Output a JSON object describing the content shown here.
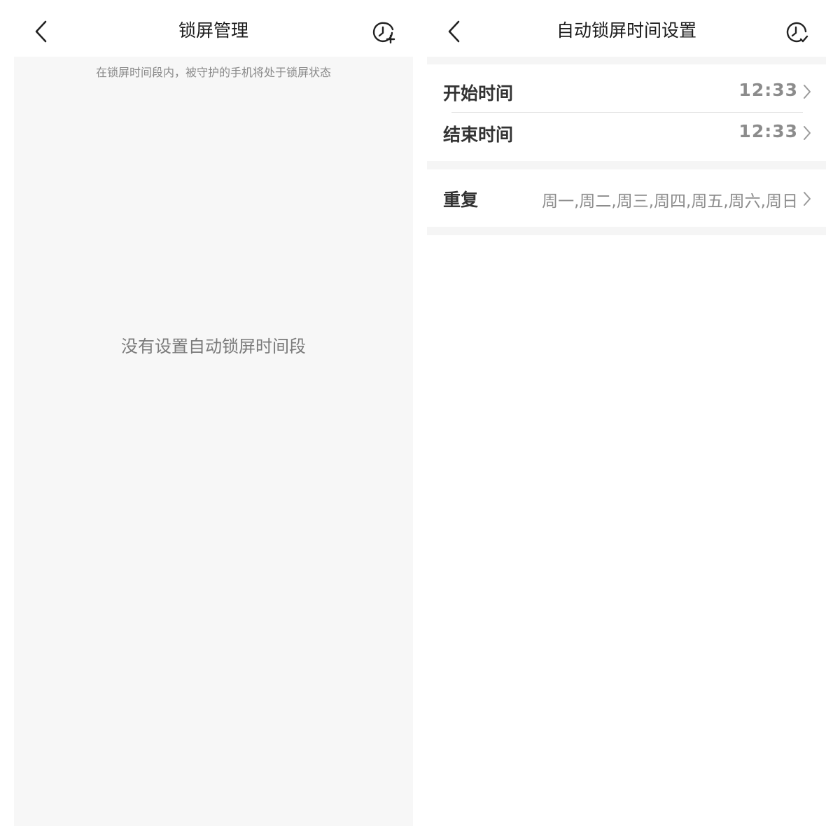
{
  "left": {
    "title": "锁屏管理",
    "hint": "在锁屏时间段内，被守护的手机将处于锁屏状态",
    "empty_message": "没有设置自动锁屏时间段"
  },
  "right": {
    "title": "自动锁屏时间设置",
    "start": {
      "label": "开始时间",
      "value": "12:33"
    },
    "end": {
      "label": "结束时间",
      "value": "12:33"
    },
    "repeat": {
      "label": "重复",
      "value": "周一,周二,周三,周四,周五,周六,周日"
    }
  },
  "icons": {
    "back": "chevron-left-icon",
    "add_schedule": "clock-plus-icon",
    "confirm_schedule": "clock-check-icon",
    "row_arrow": "chevron-right-icon"
  }
}
